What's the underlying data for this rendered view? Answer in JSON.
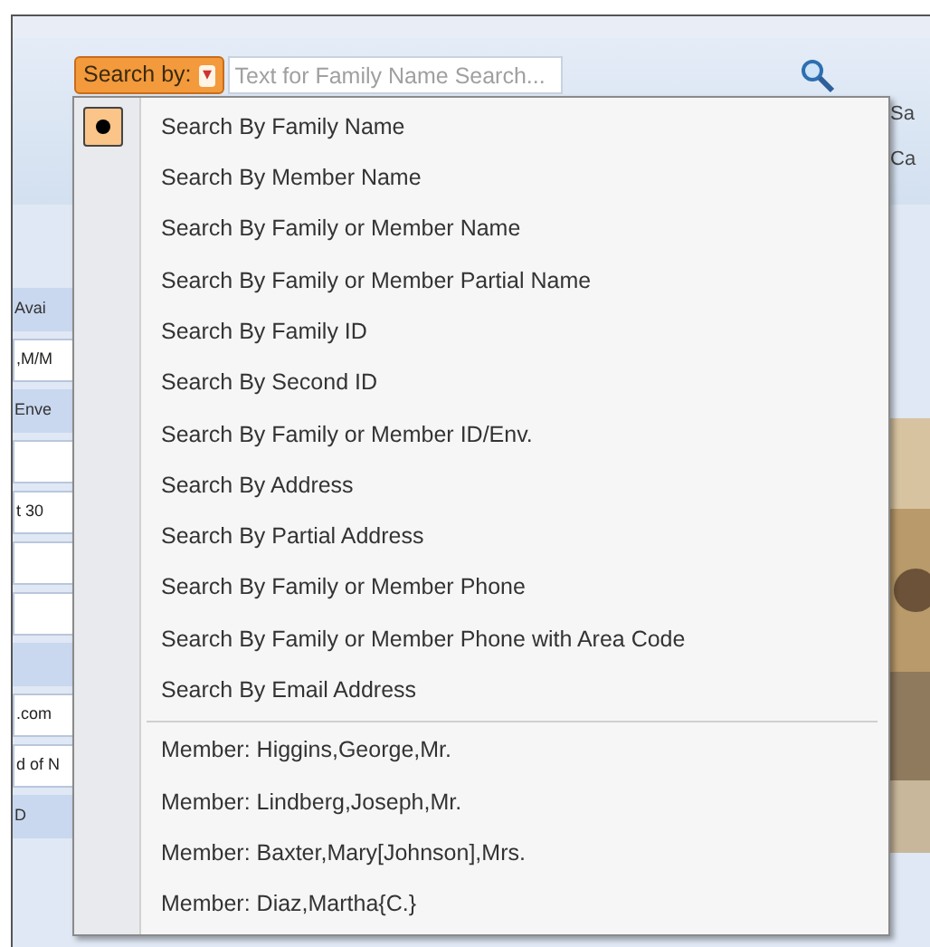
{
  "toolbar": {
    "search_button": "Search by:",
    "search_button_caret": "▾",
    "search_field": {
      "placeholder": "Text for Family Name Search..."
    },
    "right_labels": [
      "Sa",
      "Ca"
    ]
  },
  "background_fields": [
    {
      "text": "Avai",
      "kind": "label"
    },
    {
      "text": ",M/M",
      "kind": "field"
    },
    {
      "text": "Enve",
      "kind": "label"
    },
    {
      "kind": "field"
    },
    {
      "text": "t 30",
      "kind": "field"
    },
    {
      "kind": "field"
    },
    {
      "kind": "field"
    },
    {
      "kind": "label"
    },
    {
      "text": ".com",
      "kind": "field"
    },
    {
      "text": "d of N",
      "kind": "field"
    },
    {
      "text": "D",
      "kind": "label"
    }
  ],
  "menu": {
    "items": [
      {
        "kind": "search",
        "label": "Search By Family Name",
        "selected": true
      },
      {
        "kind": "search",
        "label": "Search By Member Name",
        "selected": false
      },
      {
        "kind": "search",
        "label": "Search By Family or Member Name",
        "selected": false
      },
      {
        "kind": "search",
        "label": "Search By Family or Member Partial Name",
        "selected": false
      },
      {
        "kind": "search",
        "label": "Search By Family ID",
        "selected": false
      },
      {
        "kind": "search",
        "label": "Search By Second ID",
        "selected": false
      },
      {
        "kind": "search",
        "label": "Search By Family or Member ID/Env.",
        "selected": false
      },
      {
        "kind": "search",
        "label": "Search By Address",
        "selected": false
      },
      {
        "kind": "search",
        "label": "Search By Partial Address",
        "selected": false
      },
      {
        "kind": "search",
        "label": "Search By Family or Member Phone",
        "selected": false
      },
      {
        "kind": "search",
        "label": "Search By Family or Member Phone with Area Code",
        "selected": false
      },
      {
        "kind": "search",
        "label": "Search By Email Address",
        "selected": false
      },
      {
        "kind": "separator"
      },
      {
        "kind": "member",
        "label": "Member: Higgins,George,Mr."
      },
      {
        "kind": "member",
        "label": "Member: Lindberg,Joseph,Mr."
      },
      {
        "kind": "member",
        "label": "Member: Baxter,Mary[Johnson],Mrs."
      },
      {
        "kind": "member",
        "label": "Member: Diaz,Martha{C.}"
      }
    ]
  }
}
